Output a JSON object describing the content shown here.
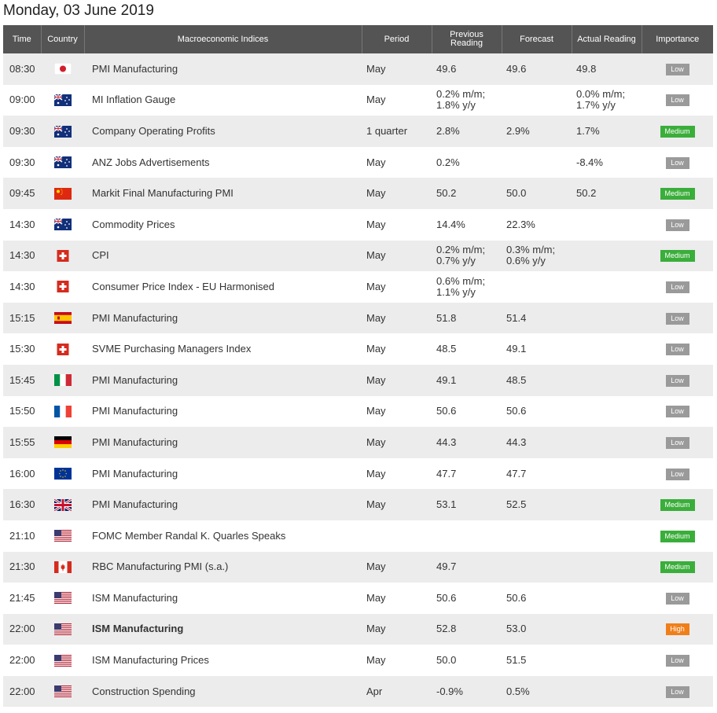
{
  "page_title": "Monday, 03 June 2019",
  "columns": {
    "time": "Time",
    "country": "Country",
    "index": "Macroeconomic Indices",
    "period": "Period",
    "previous": "Previous Reading",
    "forecast": "Forecast",
    "actual": "Actual Reading",
    "importance": "Importance"
  },
  "colors": {
    "header_bg": "#545454",
    "row_alt": "#ececec",
    "positive": "#3a9a3a",
    "negative": "#e03030",
    "low": "#9a9a9a",
    "medium": "#3aae3a",
    "high": "#f07f1a"
  },
  "rows": [
    {
      "time": "08:30",
      "country": "japan-flag-icon",
      "index": "PMI Manufacturing",
      "period": "May",
      "previous": "49.6",
      "forecast": "49.6",
      "actual": "49.8",
      "actual_tone": "green",
      "importance": "Low"
    },
    {
      "time": "09:00",
      "country": "australia-flag-icon",
      "index": "MI Inflation Gauge",
      "period": "May",
      "previous": "0.2% m/m;\n1.8% y/y",
      "forecast": "",
      "actual": "0.0% m/m;\n1.7% y/y",
      "actual_tone": "",
      "importance": "Low"
    },
    {
      "time": "09:30",
      "country": "australia-flag-icon",
      "index": "Company Operating Profits",
      "period": "1 quarter",
      "previous": "2.8%",
      "forecast": "2.9%",
      "actual": "1.7%",
      "actual_tone": "red",
      "importance": "Medium"
    },
    {
      "time": "09:30",
      "country": "australia-flag-icon",
      "index": "ANZ Jobs Advertisements",
      "period": "May",
      "previous": "0.2%",
      "forecast": "",
      "actual": "-8.4%",
      "actual_tone": "",
      "importance": "Low"
    },
    {
      "time": "09:45",
      "country": "china-flag-icon",
      "index": "Markit Final Manufacturing PMI",
      "period": "May",
      "previous": "50.2",
      "forecast": "50.0",
      "actual": "50.2",
      "actual_tone": "green",
      "importance": "Medium"
    },
    {
      "time": "14:30",
      "country": "australia-flag-icon",
      "index": "Commodity Prices",
      "period": "May",
      "previous": "14.4%",
      "forecast": "22.3%",
      "actual": "",
      "actual_tone": "",
      "importance": "Low"
    },
    {
      "time": "14:30",
      "country": "switzerland-flag-icon",
      "index": "CPI",
      "period": "May",
      "previous": "0.2% m/m;\n0.7% y/y",
      "forecast": "0.3% m/m;\n0.6% y/y",
      "actual": "",
      "actual_tone": "",
      "importance": "Medium"
    },
    {
      "time": "14:30",
      "country": "switzerland-flag-icon",
      "index": "Consumer Price Index - EU Harmonised",
      "period": "May",
      "previous": "0.6% m/m;\n1.1% y/y",
      "forecast": "",
      "actual": "",
      "actual_tone": "",
      "importance": "Low"
    },
    {
      "time": "15:15",
      "country": "spain-flag-icon",
      "index": "PMI Manufacturing",
      "period": "May",
      "previous": "51.8",
      "forecast": "51.4",
      "actual": "",
      "actual_tone": "",
      "importance": "Low"
    },
    {
      "time": "15:30",
      "country": "switzerland-flag-icon",
      "index": "SVME Purchasing Managers Index",
      "period": "May",
      "previous": "48.5",
      "forecast": "49.1",
      "actual": "",
      "actual_tone": "",
      "importance": "Low"
    },
    {
      "time": "15:45",
      "country": "italy-flag-icon",
      "index": "PMI Manufacturing",
      "period": "May",
      "previous": "49.1",
      "forecast": "48.5",
      "actual": "",
      "actual_tone": "",
      "importance": "Low"
    },
    {
      "time": "15:50",
      "country": "france-flag-icon",
      "index": "PMI Manufacturing",
      "period": "May",
      "previous": "50.6",
      "forecast": "50.6",
      "actual": "",
      "actual_tone": "",
      "importance": "Low"
    },
    {
      "time": "15:55",
      "country": "germany-flag-icon",
      "index": "PMI Manufacturing",
      "period": "May",
      "previous": "44.3",
      "forecast": "44.3",
      "actual": "",
      "actual_tone": "",
      "importance": "Low"
    },
    {
      "time": "16:00",
      "country": "eu-flag-icon",
      "index": "PMI Manufacturing",
      "period": "May",
      "previous": "47.7",
      "forecast": "47.7",
      "actual": "",
      "actual_tone": "",
      "importance": "Low"
    },
    {
      "time": "16:30",
      "country": "uk-flag-icon",
      "index": "PMI Manufacturing",
      "period": "May",
      "previous": "53.1",
      "forecast": "52.5",
      "actual": "",
      "actual_tone": "",
      "importance": "Medium"
    },
    {
      "time": "21:10",
      "country": "usa-flag-icon",
      "index": "FOMC Member Randal K. Quarles Speaks",
      "period": "",
      "previous": "",
      "forecast": "",
      "actual": "",
      "actual_tone": "",
      "importance": "Medium"
    },
    {
      "time": "21:30",
      "country": "canada-flag-icon",
      "index": "RBC Manufacturing PMI (s.a.)",
      "period": "May",
      "previous": "49.7",
      "forecast": "",
      "actual": "",
      "actual_tone": "",
      "importance": "Medium"
    },
    {
      "time": "21:45",
      "country": "usa-flag-icon",
      "index": "ISM Manufacturing",
      "period": "May",
      "previous": "50.6",
      "forecast": "50.6",
      "actual": "",
      "actual_tone": "",
      "importance": "Low"
    },
    {
      "time": "22:00",
      "country": "usa-flag-icon",
      "index": "ISM Manufacturing",
      "period": "May",
      "previous": "52.8",
      "forecast": "53.0",
      "actual": "",
      "actual_tone": "",
      "importance": "High",
      "bold": true
    },
    {
      "time": "22:00",
      "country": "usa-flag-icon",
      "index": "ISM Manufacturing Prices",
      "period": "May",
      "previous": "50.0",
      "forecast": "51.5",
      "actual": "",
      "actual_tone": "",
      "importance": "Low"
    },
    {
      "time": "22:00",
      "country": "usa-flag-icon",
      "index": "Construction Spending",
      "period": "Apr",
      "previous": "-0.9%",
      "forecast": "0.5%",
      "actual": "",
      "actual_tone": "",
      "importance": "Low"
    }
  ]
}
